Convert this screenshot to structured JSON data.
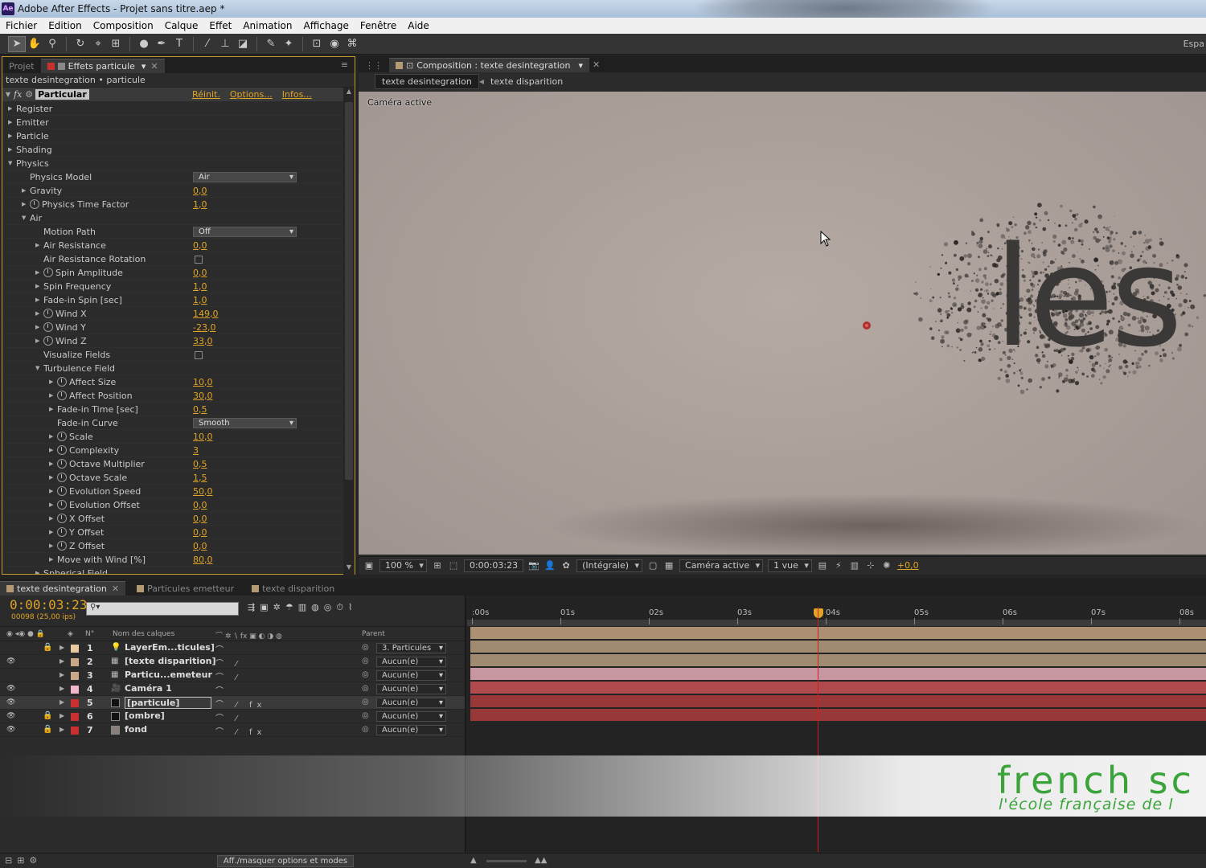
{
  "window": {
    "title": "Adobe After Effects - Projet sans titre.aep *",
    "app_icon": "Ae"
  },
  "menu": [
    "Fichier",
    "Edition",
    "Composition",
    "Calque",
    "Effet",
    "Animation",
    "Affichage",
    "Fenêtre",
    "Aide"
  ],
  "toolbar": {
    "workspace_label": "Espa"
  },
  "left_panel": {
    "tabs": [
      {
        "label": "Projet"
      },
      {
        "label": "Effets particule"
      }
    ],
    "breadcrumb": "texte desintegration • particule",
    "effect": {
      "name": "Particular",
      "badge": "fx",
      "links": [
        "Réinit.",
        "Options...",
        "Infos..."
      ]
    },
    "rows": [
      {
        "label": "Register",
        "indent": 1,
        "twirl": "closed"
      },
      {
        "label": "Emitter",
        "indent": 1,
        "twirl": "closed"
      },
      {
        "label": "Particle",
        "indent": 1,
        "twirl": "closed"
      },
      {
        "label": "Shading",
        "indent": 1,
        "twirl": "closed"
      },
      {
        "label": "Physics",
        "indent": 1,
        "twirl": "open"
      },
      {
        "label": "Physics Model",
        "indent": 2,
        "twirl": "none",
        "dropdown": "Air"
      },
      {
        "label": "Gravity",
        "indent": 2,
        "twirl": "closed",
        "value": "0,0"
      },
      {
        "label": "Physics Time Factor",
        "indent": 2,
        "twirl": "closed",
        "stopwatch": true,
        "value": "1,0"
      },
      {
        "label": "Air",
        "indent": 2,
        "twirl": "open"
      },
      {
        "label": "Motion Path",
        "indent": 3,
        "twirl": "none",
        "dropdown": "Off"
      },
      {
        "label": "Air Resistance",
        "indent": 3,
        "twirl": "closed",
        "value": "0,0"
      },
      {
        "label": "Air Resistance Rotation",
        "indent": 3,
        "twirl": "none",
        "checkbox": true
      },
      {
        "label": "Spin Amplitude",
        "indent": 3,
        "twirl": "closed",
        "stopwatch": true,
        "value": "0,0"
      },
      {
        "label": "Spin Frequency",
        "indent": 3,
        "twirl": "closed",
        "value": "1,0"
      },
      {
        "label": "Fade-in Spin [sec]",
        "indent": 3,
        "twirl": "closed",
        "value": "1,0"
      },
      {
        "label": "Wind X",
        "indent": 3,
        "twirl": "closed",
        "stopwatch": true,
        "value": "149,0"
      },
      {
        "label": "Wind Y",
        "indent": 3,
        "twirl": "closed",
        "stopwatch": true,
        "value": "-23,0"
      },
      {
        "label": "Wind Z",
        "indent": 3,
        "twirl": "closed",
        "stopwatch": true,
        "value": "33,0"
      },
      {
        "label": "Visualize Fields",
        "indent": 3,
        "twirl": "none",
        "checkbox": true
      },
      {
        "label": "Turbulence Field",
        "indent": 3,
        "twirl": "open"
      },
      {
        "label": "Affect Size",
        "indent": 4,
        "twirl": "closed",
        "stopwatch": true,
        "value": "10,0"
      },
      {
        "label": "Affect Position",
        "indent": 4,
        "twirl": "closed",
        "stopwatch": true,
        "value": "30,0"
      },
      {
        "label": "Fade-in Time [sec]",
        "indent": 4,
        "twirl": "closed",
        "value": "0,5"
      },
      {
        "label": "Fade-in Curve",
        "indent": 4,
        "twirl": "none",
        "dropdown": "Smooth"
      },
      {
        "label": "Scale",
        "indent": 4,
        "twirl": "closed",
        "stopwatch": true,
        "value": "10,0"
      },
      {
        "label": "Complexity",
        "indent": 4,
        "twirl": "closed",
        "stopwatch": true,
        "value": "3"
      },
      {
        "label": "Octave Multiplier",
        "indent": 4,
        "twirl": "closed",
        "stopwatch": true,
        "value": "0,5"
      },
      {
        "label": "Octave Scale",
        "indent": 4,
        "twirl": "closed",
        "stopwatch": true,
        "value": "1,5"
      },
      {
        "label": "Evolution Speed",
        "indent": 4,
        "twirl": "closed",
        "stopwatch": true,
        "value": "50,0"
      },
      {
        "label": "Evolution Offset",
        "indent": 4,
        "twirl": "closed",
        "stopwatch": true,
        "value": "0,0"
      },
      {
        "label": "X Offset",
        "indent": 4,
        "twirl": "closed",
        "stopwatch": true,
        "value": "0,0"
      },
      {
        "label": "Y Offset",
        "indent": 4,
        "twirl": "closed",
        "stopwatch": true,
        "value": "0,0"
      },
      {
        "label": "Z Offset",
        "indent": 4,
        "twirl": "closed",
        "stopwatch": true,
        "value": "0,0"
      },
      {
        "label": "Move with Wind [%]",
        "indent": 4,
        "twirl": "closed",
        "value": "80,0"
      },
      {
        "label": "Spherical Field",
        "indent": 3,
        "twirl": "closed"
      }
    ]
  },
  "comp_panel": {
    "tab": "Composition : texte desintegration",
    "breadcrumbs": [
      "texte desintegration",
      "texte disparition"
    ],
    "viewer_label": "Caméra active",
    "viewer_text": "les",
    "footer": {
      "zoom": "100 %",
      "timecode": "0:00:03:23",
      "resolution": "(Intégrale)",
      "camera": "Caméra active",
      "views": "1 vue",
      "exposure": "+0,0"
    }
  },
  "timeline": {
    "tabs": [
      {
        "label": "texte desintegration",
        "color": "#b49a73"
      },
      {
        "label": "Particules emetteur",
        "color": "#b49a73"
      },
      {
        "label": "texte disparition",
        "color": "#b49a73"
      }
    ],
    "timecode": "0:00:03:23",
    "frame_info": "00098 (25,00 ips)",
    "search_placeholder": "",
    "col_num": "N°",
    "col_name": "Nom des calques",
    "col_parent": "Parent",
    "ruler": [
      ":00s",
      "01s",
      "02s",
      "03s",
      "04s",
      "05s",
      "06s",
      "07s",
      "08s"
    ],
    "ruler_seconds": [
      0,
      1,
      2,
      3,
      4,
      5,
      6,
      7,
      8
    ],
    "current_time_seconds": 3.92,
    "layers": [
      {
        "num": "1",
        "name": "LayerEm...ticules]",
        "type": "light",
        "label_color": "#e8c8a0",
        "parent": "3. Particules",
        "bar_color": "#ad8f73",
        "visible": false,
        "locked": true
      },
      {
        "num": "2",
        "name": "[texte disparition]",
        "type": "comp",
        "label_color": "#c8a888",
        "parent": "Aucun(e)",
        "bar_color": "#a08a70",
        "visible": true,
        "locked": false
      },
      {
        "num": "3",
        "name": "Particu...emeteur",
        "type": "comp",
        "label_color": "#c8a888",
        "parent": "Aucun(e)",
        "bar_color": "#a08a70",
        "visible": false,
        "locked": false
      },
      {
        "num": "4",
        "name": "Caméra 1",
        "type": "camera",
        "label_color": "#f0b8c8",
        "parent": "Aucun(e)",
        "bar_color": "#c896a0",
        "visible": true,
        "locked": false
      },
      {
        "num": "5",
        "name": "[particule]",
        "type": "solid",
        "label_color": "#c83030",
        "parent": "Aucun(e)",
        "bar_color": "#b04a4e",
        "visible": true,
        "locked": false,
        "selected": true
      },
      {
        "num": "6",
        "name": "[ombre]",
        "type": "solid",
        "label_color": "#c83030",
        "parent": "Aucun(e)",
        "bar_color": "#983838",
        "visible": true,
        "locked": true
      },
      {
        "num": "7",
        "name": "fond",
        "type": "solid",
        "label_color": "#c83030",
        "parent": "Aucun(e)",
        "bar_color": "#983838",
        "visible": true,
        "locked": true
      }
    ]
  },
  "watermark": {
    "title": "french sc",
    "subtitle": "l'école française de l"
  },
  "bottom": {
    "toggle_label": "Aff./masquer options et modes"
  },
  "colors": {
    "accent": "#e0a526",
    "panel_highlight": "#c99a2d",
    "cti": "#d02020"
  }
}
